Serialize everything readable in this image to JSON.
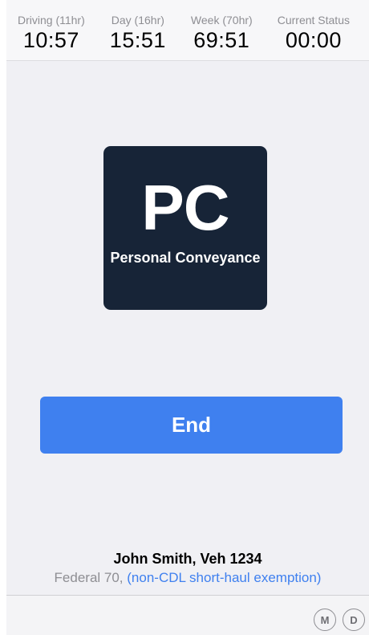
{
  "clocks": [
    {
      "label": "Driving (11hr)",
      "value": "10:57"
    },
    {
      "label": "Day (16hr)",
      "value": "15:51"
    },
    {
      "label": "Week (70hr)",
      "value": "69:51"
    },
    {
      "label": "Current Status",
      "value": "00:00"
    }
  ],
  "status": {
    "code": "PC",
    "name": "Personal Conveyance"
  },
  "end_button": {
    "label": "End"
  },
  "driver": {
    "line": "John Smith, Veh 1234",
    "ruleset": "Federal 70,",
    "exemption": "(non-CDL short-haul exemption)"
  },
  "footer": {
    "m_label": "M",
    "d_label": "D"
  },
  "colors": {
    "accent": "#3f80ef",
    "tile": "#172437",
    "background": "#f0f0f4"
  }
}
